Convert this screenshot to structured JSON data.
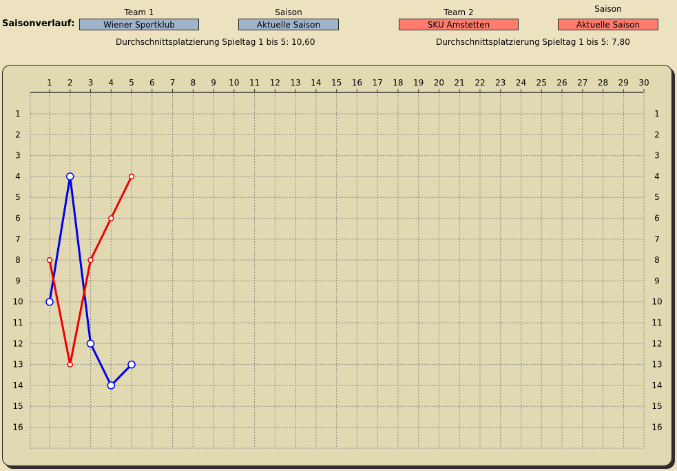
{
  "header": {
    "title": "Saisonverlauf:",
    "team1_caption": "Team 1",
    "season1_caption": "Saison",
    "team2_caption": "Team 2",
    "season2_caption": "Saison",
    "team1_value": "Wiener Sportklub",
    "season1_value": "Aktuelle Saison",
    "team2_value": "SKU Amstetten",
    "season2_value": "Aktuelle Saison",
    "avg1": "Durchschnittsplatzierung Spieltag 1 bis 5: 10,60",
    "avg2": "Durchschnittsplatzierung Spieltag 1 bis 5:  7,80"
  },
  "colors": {
    "team1": "#0000ee",
    "team2": "#ee0000",
    "team1_button": "#a0b4cc",
    "team2_button": "#ff7b6e",
    "background": "#ece2c0",
    "panel": "#e0d9b1"
  },
  "chart_data": {
    "type": "line",
    "x_range": [
      1,
      30
    ],
    "y_range": [
      1,
      16
    ],
    "y_inverted": true,
    "x_axis_position": "top",
    "y_axis_position": "left-and-right",
    "grid": true,
    "x_ticks": [
      1,
      2,
      3,
      4,
      5,
      6,
      7,
      8,
      9,
      10,
      11,
      12,
      13,
      14,
      15,
      16,
      17,
      18,
      19,
      20,
      21,
      22,
      23,
      24,
      25,
      26,
      27,
      28,
      29,
      30
    ],
    "y_ticks": [
      1,
      2,
      3,
      4,
      5,
      6,
      7,
      8,
      9,
      10,
      11,
      12,
      13,
      14,
      15,
      16
    ],
    "series": [
      {
        "name": "Wiener Sportklub",
        "color": "#0000ee",
        "x": [
          1,
          2,
          3,
          4,
          5
        ],
        "y": [
          10,
          4,
          12,
          14,
          13
        ]
      },
      {
        "name": "SKU Amstetten",
        "color": "#ee0000",
        "x": [
          1,
          2,
          3,
          4,
          5
        ],
        "y": [
          8,
          13,
          8,
          6,
          4
        ]
      }
    ]
  }
}
